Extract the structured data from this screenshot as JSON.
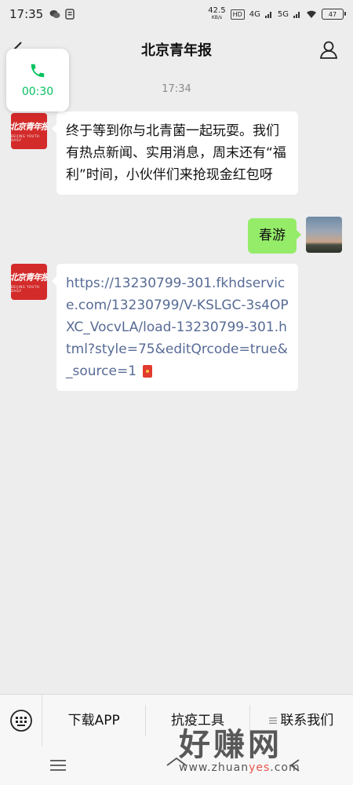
{
  "status_bar": {
    "time": "17:35",
    "net_speed": "42.5",
    "net_unit": "KB/s",
    "hd_badge": "HD",
    "signal1": "4G",
    "signal2": "5G",
    "battery": "47"
  },
  "header": {
    "title": "北京青年报"
  },
  "call_float": {
    "duration": "00:30"
  },
  "chat": {
    "timestamp": "17:34",
    "messages": [
      {
        "side": "left",
        "sender_logo": "北京青年报",
        "sender_logo_sub": "BEIJING YOUTH DAILY",
        "text": "终于等到你与北青菌一起玩耍。我们有热点新闻、实用消息，周末还有“福利”时间，小伙伴们来抢现金红包呀"
      },
      {
        "side": "right",
        "text": "春游"
      },
      {
        "side": "left",
        "sender_logo": "北京青年报",
        "sender_logo_sub": "BEIJING YOUTH DAILY",
        "link": "https://13230799-301.fkhdservice.com/13230799/V-KSLGC-3s4OPXC_VocvLA/load-13230799-301.html?style=75&editQrcode=true&_source=1"
      }
    ]
  },
  "bottom_menu": {
    "items": [
      "下载APP",
      "抗疫工具",
      "联系我们"
    ]
  },
  "watermark": {
    "brand": "好赚网",
    "url_a": "www.zhuan",
    "url_b": "yes",
    "url_c": ".com"
  },
  "icons": {
    "back": "chevron-left-icon",
    "profile": "person-icon",
    "phone": "phone-icon",
    "keyboard": "keyboard-icon",
    "nav_menu": "menu-icon",
    "nav_home": "home-icon"
  },
  "colors": {
    "accent_green": "#07c160",
    "bubble_green": "#95ec69",
    "link_blue": "#576b95",
    "logo_red": "#d32a2a"
  }
}
